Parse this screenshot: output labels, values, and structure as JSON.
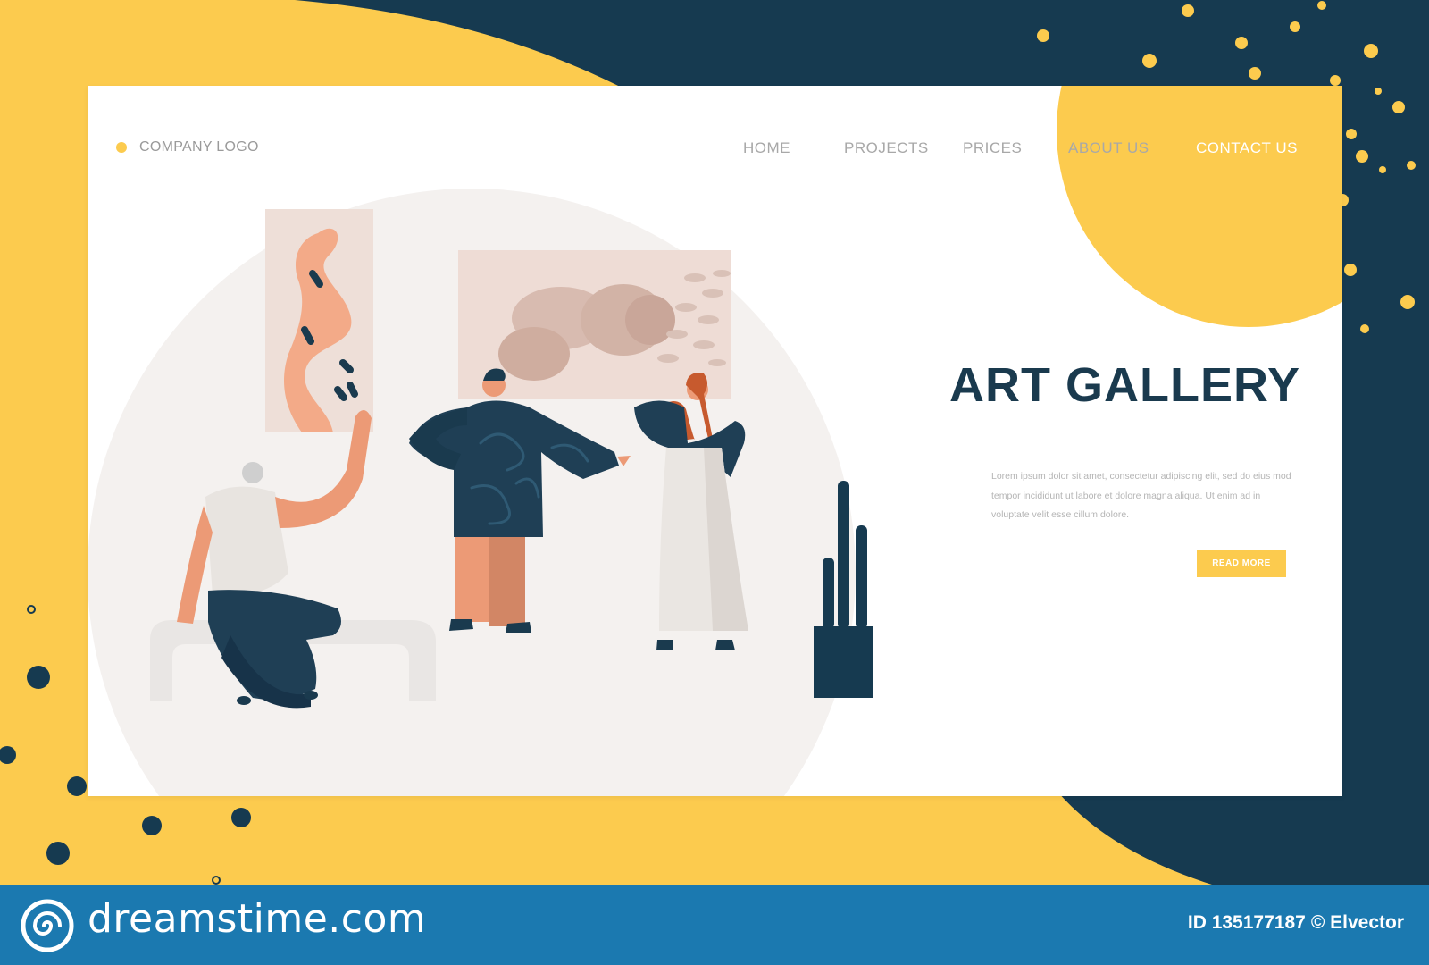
{
  "header": {
    "logo_text": "COMPANY LOGO",
    "nav": [
      "HOME",
      "PROJECTS",
      "PRICES",
      "ABOUT US",
      "CONTACT US"
    ]
  },
  "hero": {
    "title": "ART GALLERY",
    "body": "Lorem ipsum dolor sit amet, consectetur adipiscing elit, sed do eius mod tempor incididunt ut labore et dolore magna aliqua. Ut enim ad in voluptate velit esse cillum dolore.",
    "cta": "READ MORE"
  },
  "stock": {
    "wordmark": "dreamstime.com",
    "id_label": "ID 135177187",
    "credit": "© Elvector"
  },
  "colors": {
    "yellow": "#fccb4e",
    "navy": "#163a50",
    "title": "#1a3a4e",
    "bar": "#1b79b0"
  },
  "icons": {
    "logo_dot": "yellow-dot-icon",
    "stock_logo": "spiral-logo-icon"
  }
}
